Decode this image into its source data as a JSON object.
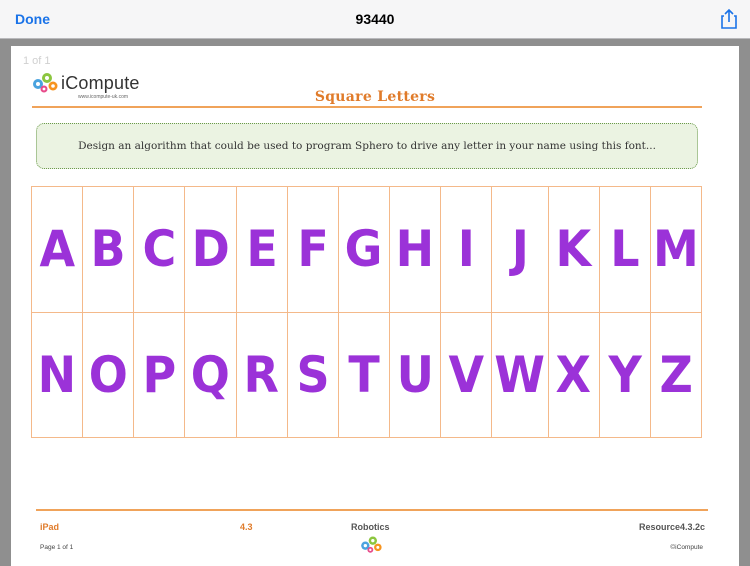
{
  "navbar": {
    "done_label": "Done",
    "title": "93440",
    "share_icon": "share-icon"
  },
  "viewer": {
    "page_count": "1 of 1"
  },
  "document": {
    "logo": {
      "name": "iCompute",
      "url": "www.icompute-uk.com",
      "icon": "gears-icon"
    },
    "title": "Square Letters",
    "instruction": "Design an algorithm that could be used to program Sphero to drive any letter in your name using this font...",
    "letters_row1": [
      "A",
      "B",
      "C",
      "D",
      "E",
      "F",
      "G",
      "H",
      "I",
      "J",
      "K",
      "L",
      "M"
    ],
    "letters_row2": [
      "N",
      "O",
      "P",
      "Q",
      "R",
      "S",
      "T",
      "U",
      "V",
      "W",
      "X",
      "Y",
      "Z"
    ],
    "footer": {
      "device": "iPad",
      "section": "4.3",
      "subject": "Robotics",
      "resource": "Resource4.3.2c",
      "page": "Page 1 of 1",
      "copyright": "©iCompute"
    }
  },
  "colors": {
    "accent_blue": "#1a73e8",
    "title_orange": "#e07b2a",
    "letter_purple": "#9b32d8",
    "box_green": "#ebf3e2"
  }
}
